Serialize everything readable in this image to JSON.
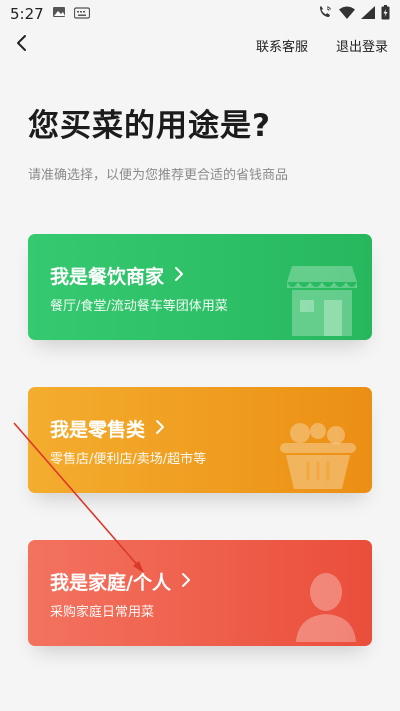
{
  "status_bar": {
    "time": "5:27",
    "icons": [
      "image-icon",
      "keyboard-icon",
      "wifi-calling-icon",
      "wifi-icon",
      "signal-icon",
      "battery-icon"
    ]
  },
  "header": {
    "back_icon": "chevron-left-icon",
    "contact_label": "联系客服",
    "logout_label": "退出登录"
  },
  "main": {
    "title": "您买菜的用途是?",
    "subtitle": "请准确选择，以便为您推荐更合适的省钱商品"
  },
  "options": [
    {
      "title": "我是餐饮商家",
      "description": "餐厅/食堂/流动餐车等团体用菜",
      "icon": "storefront-icon",
      "color": "#2cc065"
    },
    {
      "title": "我是零售类",
      "description": "零售店/便利店/卖场/超市等",
      "icon": "shopping-basket-icon",
      "color": "#ef9d20"
    },
    {
      "title": "我是家庭/个人",
      "description": "采购家庭日常用菜",
      "icon": "person-icon",
      "color": "#ee5e4a"
    }
  ],
  "annotation": {
    "color": "#d9392b"
  }
}
